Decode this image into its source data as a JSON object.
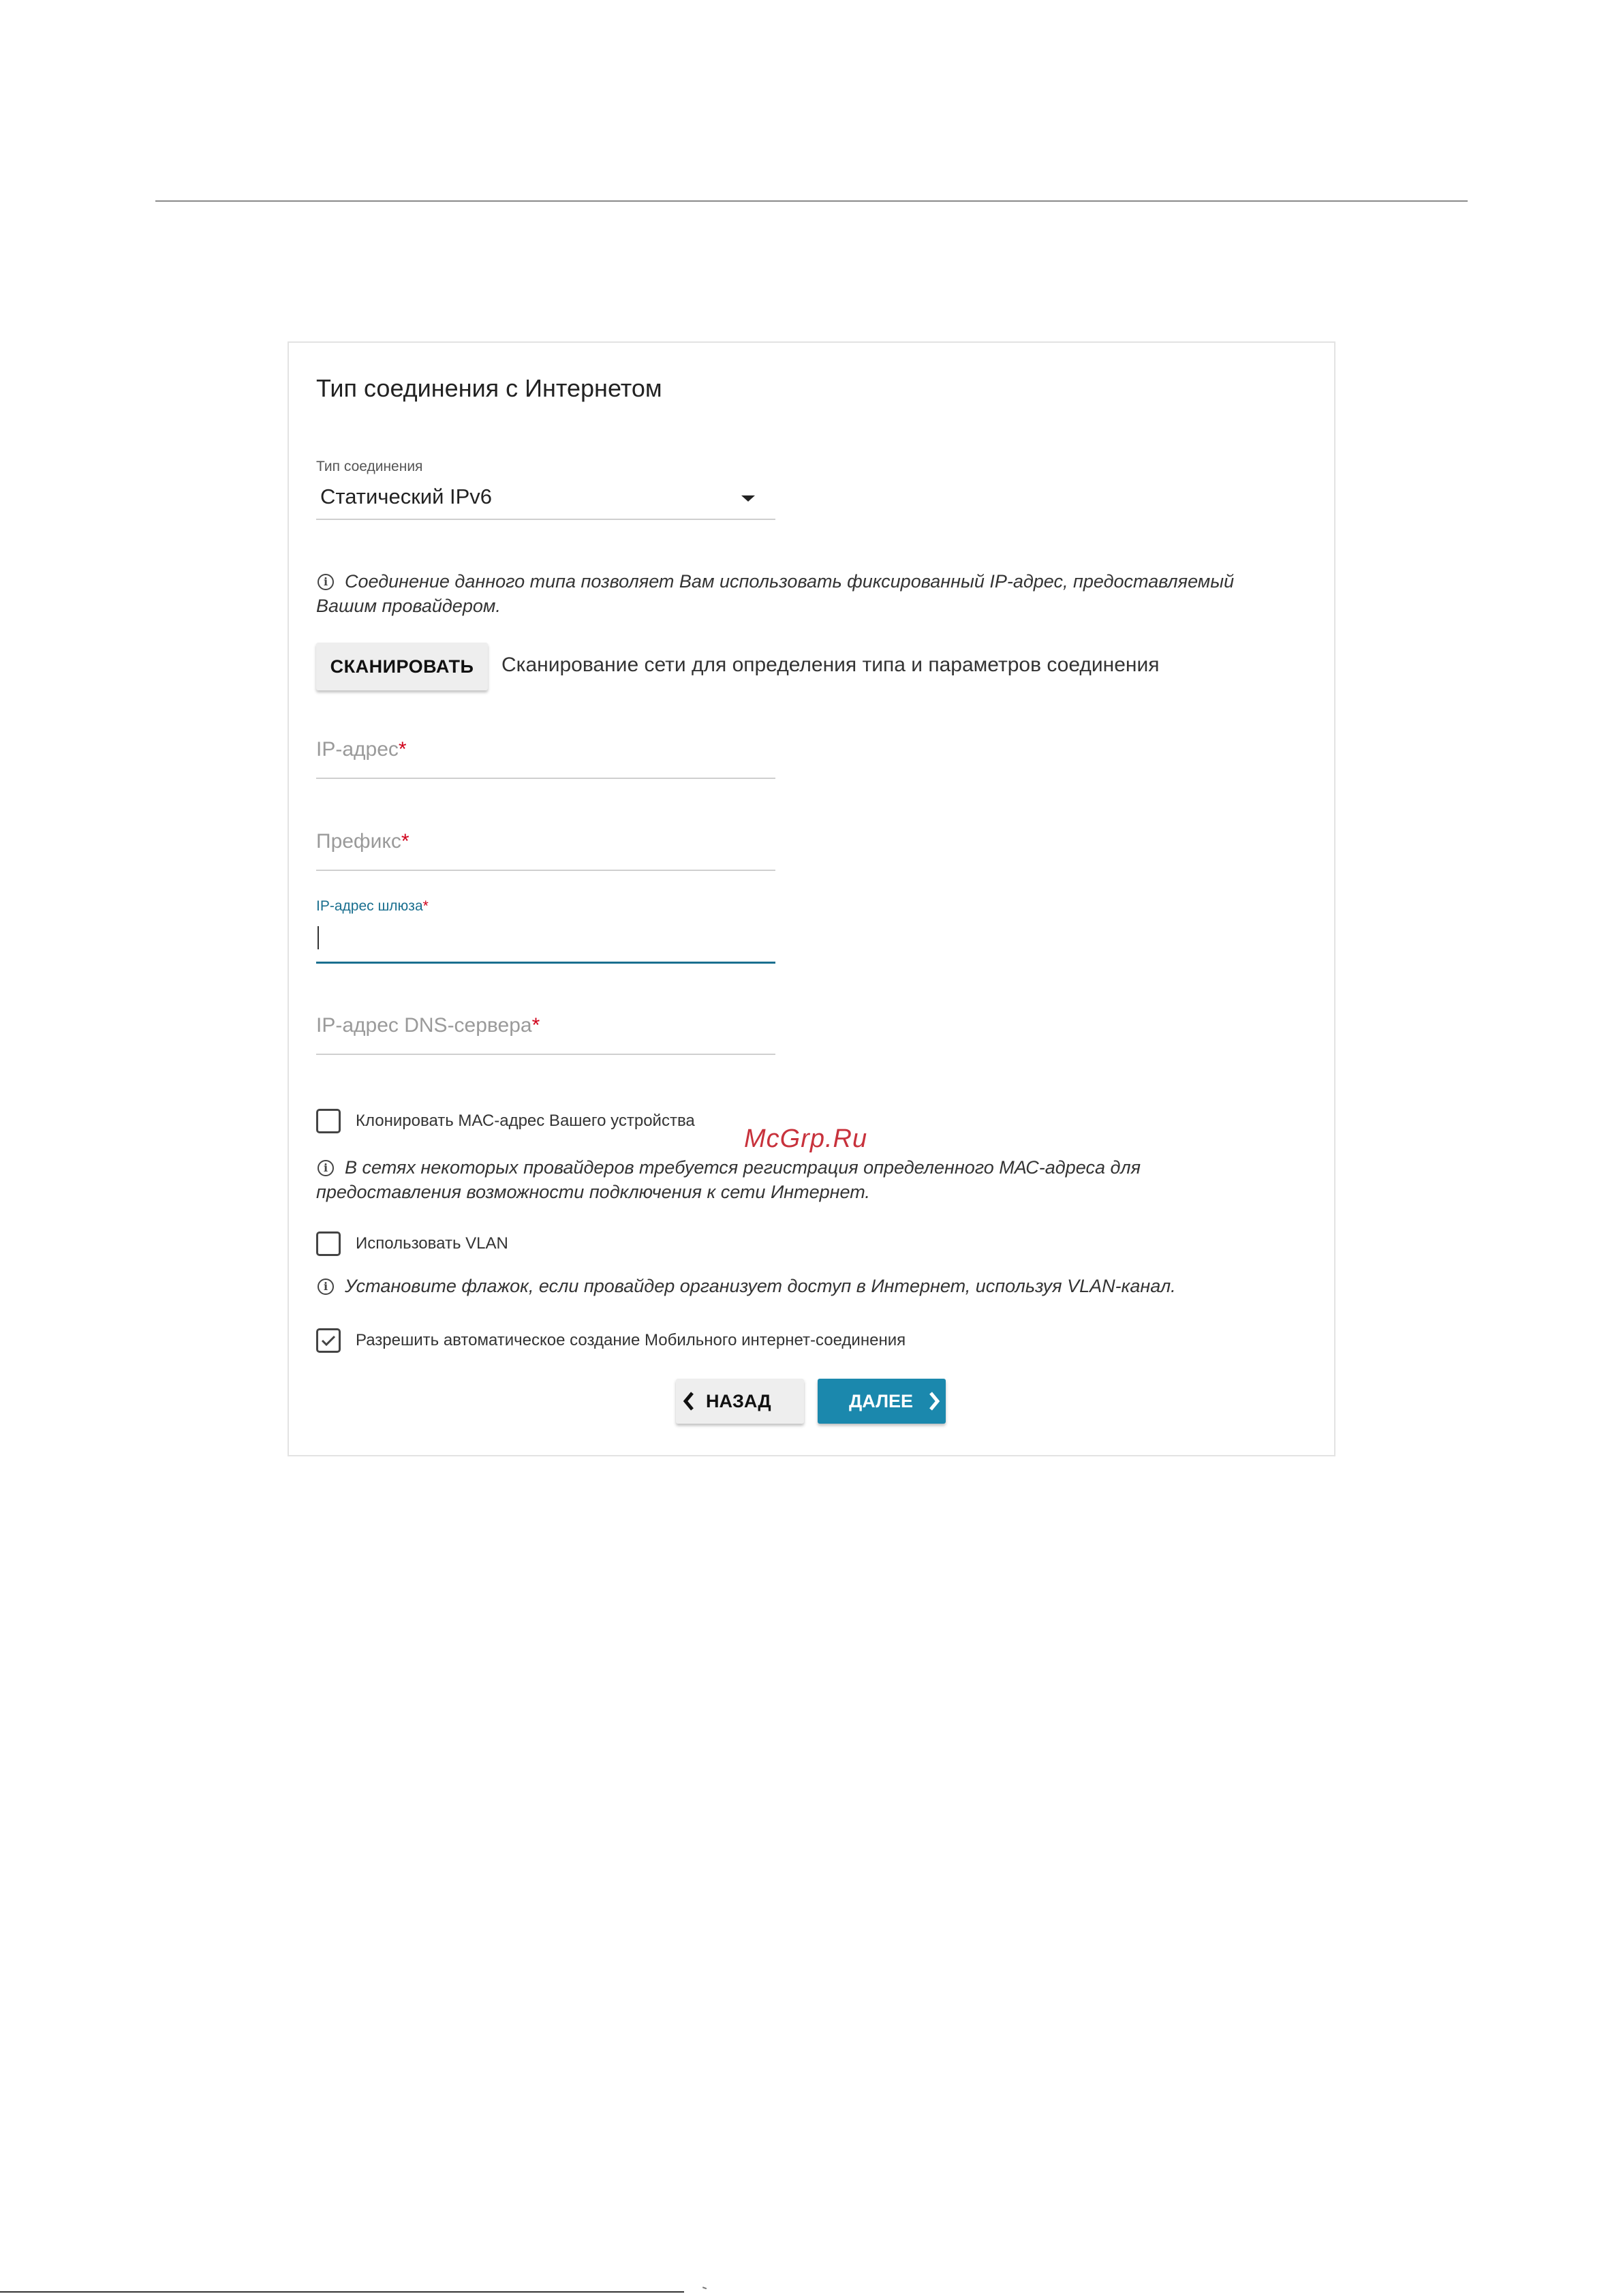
{
  "page": {
    "watermark": "McGrp.Ru"
  },
  "form": {
    "title": "Тип соединения с Интернетом",
    "connection_type": {
      "label": "Тип соединения",
      "value": "Статический IPv6"
    },
    "connection_info": "Соединение данного типа позволяет Вам использовать фиксированный IP-адрес, предоставляемый Вашим провайдером.",
    "scan": {
      "button_label": "СКАНИРОВАТЬ",
      "description": "Сканирование сети для определения типа и параметров соединения"
    },
    "ip_address": {
      "placeholder": "IP-адрес",
      "required_mark": "*"
    },
    "prefix": {
      "placeholder": "Префикс",
      "required_mark": "*"
    },
    "gateway": {
      "label": "IP-адрес шлюза",
      "required_mark": "*",
      "value": ""
    },
    "dns": {
      "placeholder": "IP-адрес DNS-сервера",
      "required_mark": "*"
    },
    "clone_mac": {
      "label": "Клонировать МАС-адрес Вашего устройства",
      "checked": false,
      "info": "В сетях некоторых провайдеров требуется регистрация определенного МАС-адреса для предоставления возможности подключения к сети Интернет."
    },
    "use_vlan": {
      "label": "Использовать VLAN",
      "checked": false,
      "info": "Установите флажок, если провайдер организует доступ в Интернет, используя VLAN-канал."
    },
    "auto_mobile": {
      "label": "Разрешить автоматическое создание Мобильного интернет-соединения",
      "checked": true
    },
    "buttons": {
      "back_label": "НАЗАД",
      "next_label": "ДАЛЕЕ"
    }
  },
  "colors": {
    "accent": "#1b88ad",
    "focus": "#1a6f8f",
    "required": "#d0021b",
    "watermark": "#c8323c"
  },
  "icons": [
    "info-icon",
    "chevron-down-icon",
    "chevron-left-icon",
    "chevron-right-icon",
    "check-icon"
  ]
}
